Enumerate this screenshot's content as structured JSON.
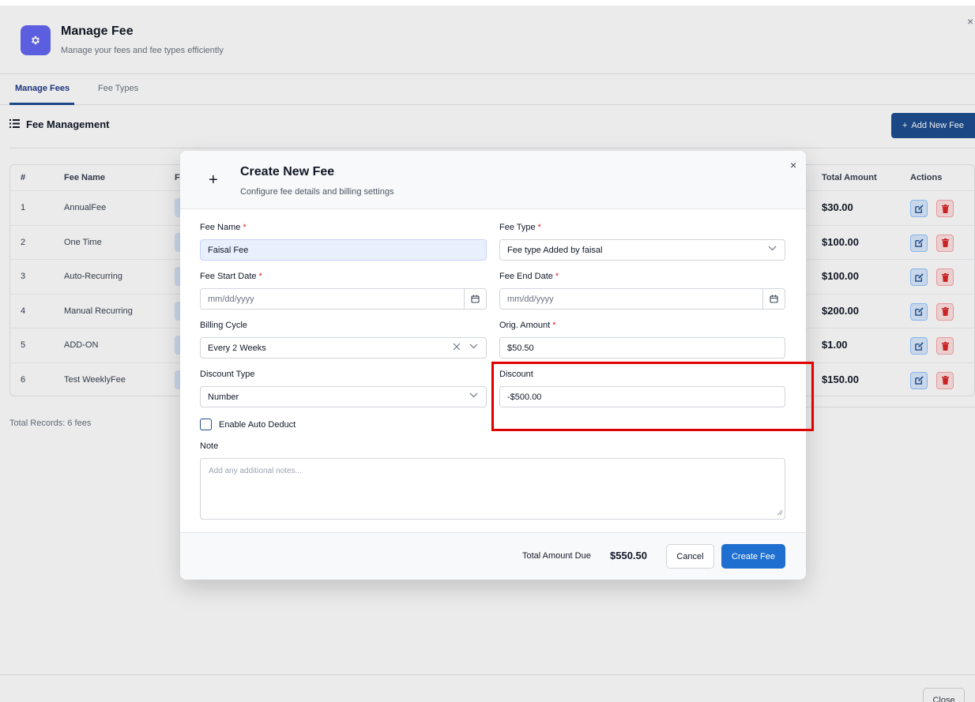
{
  "header": {
    "title": "Manage Fee",
    "subtitle": "Manage your fees and fee types efficiently",
    "close_glyph": "×",
    "icon": "gear-icon"
  },
  "tabs": [
    {
      "label": "Manage Fees",
      "active": true
    },
    {
      "label": "Fee Types",
      "active": false
    }
  ],
  "section": {
    "title": "Fee Management",
    "add_button": "Add New Fee"
  },
  "table": {
    "columns": [
      "#",
      "Fee Name",
      "F",
      "Total Amount",
      "Actions"
    ],
    "rows": [
      {
        "num": "1",
        "name": "AnnualFee",
        "amount": "$30.00"
      },
      {
        "num": "2",
        "name": "One Time",
        "amount": "$100.00"
      },
      {
        "num": "3",
        "name": "Auto-Recurring",
        "amount": "$100.00"
      },
      {
        "num": "4",
        "name": "Manual Recurring",
        "amount": "$200.00"
      },
      {
        "num": "5",
        "name": "ADD-ON",
        "amount": "$1.00"
      },
      {
        "num": "6",
        "name": "Test WeeklyFee",
        "amount": "$150.00"
      }
    ]
  },
  "total_records": "Total Records: 6 fees",
  "page_close_button": "Close",
  "modal": {
    "title": "Create New Fee",
    "subtitle": "Configure fee details and billing settings",
    "close_glyph": "×",
    "fee_name": {
      "label": "Fee Name",
      "required": "*",
      "value": "Faisal Fee"
    },
    "fee_type": {
      "label": "Fee Type",
      "required": "*",
      "value": "Fee type Added by faisal"
    },
    "start_date": {
      "label": "Fee Start Date",
      "required": "*",
      "placeholder": "mm/dd/yyyy"
    },
    "end_date": {
      "label": "Fee End Date",
      "required": "*",
      "placeholder": "mm/dd/yyyy"
    },
    "billing_cycle": {
      "label": "Billing Cycle",
      "value": "Every 2 Weeks"
    },
    "orig_amount": {
      "label": "Orig. Amount",
      "required": "*",
      "value": "$50.50"
    },
    "discount_type": {
      "label": "Discount Type",
      "value": "Number"
    },
    "discount": {
      "label": "Discount",
      "value": "-$500.00"
    },
    "auto_deduct": {
      "label": "Enable Auto Deduct",
      "checked": false
    },
    "note": {
      "label": "Note",
      "placeholder": "Add any additional notes..."
    },
    "footer": {
      "total_label": "Total Amount Due",
      "total_value": "$550.50",
      "cancel": "Cancel",
      "create": "Create Fee"
    }
  },
  "colors": {
    "primary": "#1e4f91",
    "accent_button": "#1e6fd0",
    "header_icon_bg": "#6366f1",
    "required": "#dc2626",
    "highlight": "#e00000"
  }
}
